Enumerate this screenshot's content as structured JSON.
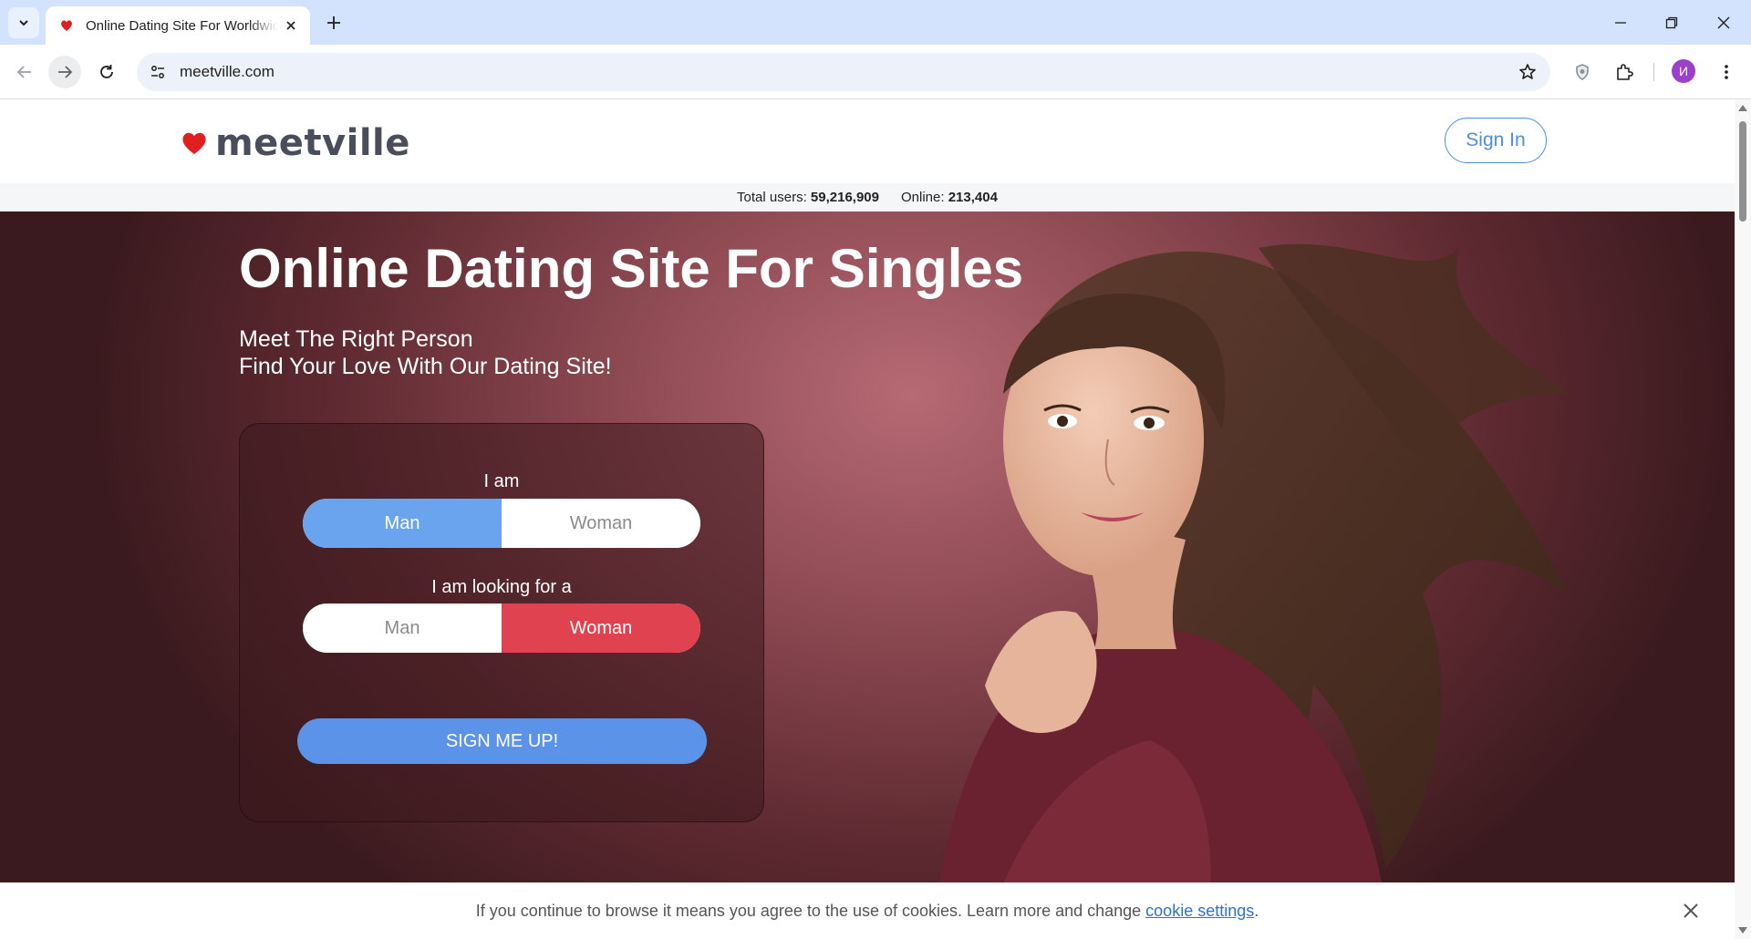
{
  "browser": {
    "tab_title": "Online Dating Site For Worldwide Singles",
    "url": "meetville.com",
    "profile_initial": "И"
  },
  "site": {
    "logo_text": "meetville",
    "signin_label": "Sign In",
    "stats": {
      "total_label": "Total users:",
      "total_value": "59,216,909",
      "online_label": "Online:",
      "online_value": "213,404"
    },
    "hero": {
      "title": "Online Dating Site For Singles",
      "subtitle_line1": "Meet The Right Person",
      "subtitle_line2": "Find Your Love With Our Dating Site!"
    },
    "form": {
      "i_am_label": "I am",
      "i_am_options": [
        "Man",
        "Woman"
      ],
      "i_am_selected": "Man",
      "looking_label": "I am looking for a",
      "looking_options": [
        "Man",
        "Woman"
      ],
      "looking_selected": "Woman",
      "submit_label": "SIGN ME UP!"
    },
    "cookie": {
      "text": "If you continue to browse it means you agree to the use of cookies. Learn more and change ",
      "link_text": "cookie settings",
      "suffix": "."
    }
  },
  "colors": {
    "accent_blue": "#4a90e2",
    "man_selected": "#6aa3ee",
    "woman_selected": "#e0434f",
    "heart_red": "#e02020"
  }
}
